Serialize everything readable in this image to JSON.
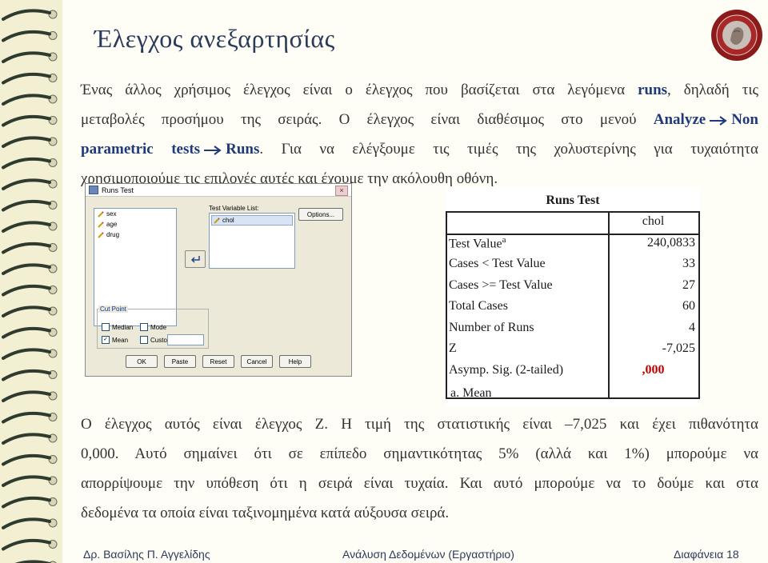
{
  "slide": {
    "title": "Έλεγχος ανεξαρτησίας",
    "intro": {
      "l1a": "Ένας άλλος χρήσιμος έλεγχος είναι ο έλεγχος που βασίζεται στα λεγόμενα ",
      "l1b": "runs",
      "l1c": ", δηλαδή τις",
      "l2a": "μεταβολές προσήμου της σειράς. Ο έλεγχος είναι διαθέσιμος στο μενού ",
      "l2b": "Analyze",
      "l2c": "Non",
      "l3a": "parametric tests",
      "l3b": "Runs",
      "l3c": ". Για να ελέγξουμε τις τιμές της χολυστερίνης για τυχαιότητα",
      "l4": "χρησιμοποιούμε τις επιλογές αυτές και έχουμε την ακόλουθη οθόνη."
    },
    "conclusion": {
      "l1": "Ο έλεγχος αυτός είναι έλεγχος Ζ. Η τιμή της στατιστικής είναι –7,025 και έχει πιθανότητα",
      "l2": "0,000. Αυτό σημαίνει ότι σε επίπεδο σημαντικότητας 5% (αλλά και 1%) μπορούμε να",
      "l3": "απορρίψουμε την υπόθεση ότι η σειρά είναι τυχαία. Και αυτό μπορούμε να το δούμε και στα",
      "l4": "δεδομένα τα οποία είναι ταξινομημένα κατά αύξουσα σειρά."
    },
    "footer": {
      "author": "Δρ. Βασίλης Π. Αγγελίδης",
      "course": "Ανάλυση Δεδομένων (Εργαστήριο)",
      "slide_no": "Διαφάνεια 18"
    },
    "colors": {
      "title": "#2a3a5a",
      "accent": "#1f3a7a",
      "significance": "#c00000"
    }
  },
  "dialog": {
    "title": "Runs Test",
    "close_glyph": "×",
    "variables": [
      "sex",
      "age",
      "drug"
    ],
    "test_variable_label": "Test Variable List:",
    "test_variables": [
      "chol"
    ],
    "options_button": "Options...",
    "cut_point_label": "Cut Point",
    "median_label": "Median",
    "median_checked": false,
    "mode_label": "Mode",
    "mode_checked": false,
    "mean_label": "Mean",
    "mean_checked": true,
    "custom_label": "Custom:",
    "custom_checked": false,
    "buttons": {
      "ok": "OK",
      "paste": "Paste",
      "reset": "Reset",
      "cancel": "Cancel",
      "help": "Help"
    }
  },
  "runs_table": {
    "title": "Runs Test",
    "column": "chol",
    "rows": [
      {
        "label": "Test Value",
        "sup": "a",
        "value": "240,0833"
      },
      {
        "label": "Cases < Test Value",
        "value": "33"
      },
      {
        "label": "Cases >= Test Value",
        "value": "27"
      },
      {
        "label": "Total Cases",
        "value": "60"
      },
      {
        "label": "Number of Runs",
        "value": "4"
      },
      {
        "label": "Z",
        "value": "-7,025"
      },
      {
        "label": "Asymp. Sig. (2-tailed)",
        "value": ",000"
      }
    ],
    "footnote": "a. Mean"
  }
}
